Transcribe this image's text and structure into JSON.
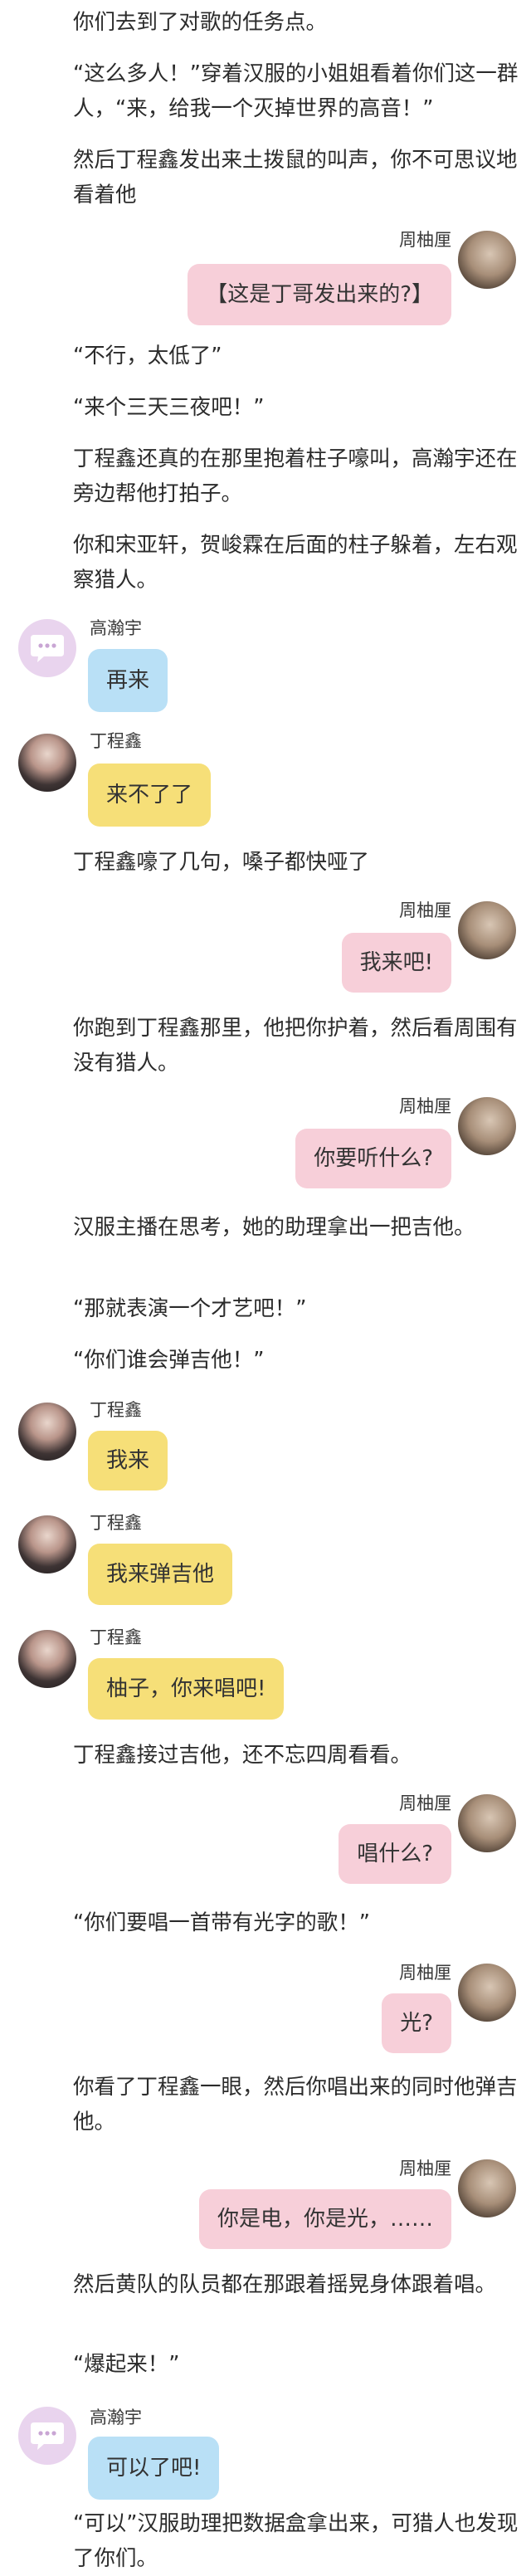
{
  "paragraphs": [
    "你们去到了对歌的任务点。",
    "“这么多人！”穿着汉服的小姐姐看着你们这一群人，“来，给我一个灭掉世界的高音！”",
    "然后丁程鑫发出来土拨鼠的叫声，你不可思议地看着他",
    "“不行，太低了”",
    "“来个三天三夜吧！”",
    "丁程鑫还真的在那里抱着柱子嚎叫，高瀚宇还在旁边帮他打拍子。",
    "你和宋亚轩，贺峻霖在后面的柱子躲着，左右观察猎人。",
    "丁程鑫嚎了几句，嗓子都快哑了",
    "你跑到丁程鑫那里，他把你护着，然后看周围有没有猎人。",
    "汉服主播在思考，她的助理拿出一把吉他。",
    "“那就表演一个才艺吧！”",
    "“你们谁会弹吉他！”",
    "丁程鑫接过吉他，还不忘四周看看。",
    "“你们要唱一首带有光字的歌！”",
    "你看了丁程鑫一眼，然后你唱出来的同时他弹吉他。",
    "然后黄队的队员都在那跟着摇晃身体跟着唱。",
    "“爆起来！”",
    "“可以”汉服助理把数据盒拿出来，可猎人也发现了你们。"
  ],
  "speakers": {
    "zhou": "周柚厘",
    "gao": "高瀚宇",
    "ding": "丁程鑫"
  },
  "messages": [
    "【这是丁哥发出来的?】",
    "再来",
    "来不了了",
    "我来吧!",
    "你要听什么?",
    "我来",
    "我来弹吉他",
    "柚子，你来唱吧!",
    "唱什么?",
    "光?",
    "你是电，你是光，……",
    "可以了吧!"
  ],
  "colors": {
    "pink_bubble": "#f7cfd9",
    "blue_bubble": "#b9e0f6",
    "yellow_bubble": "#f6df78"
  }
}
